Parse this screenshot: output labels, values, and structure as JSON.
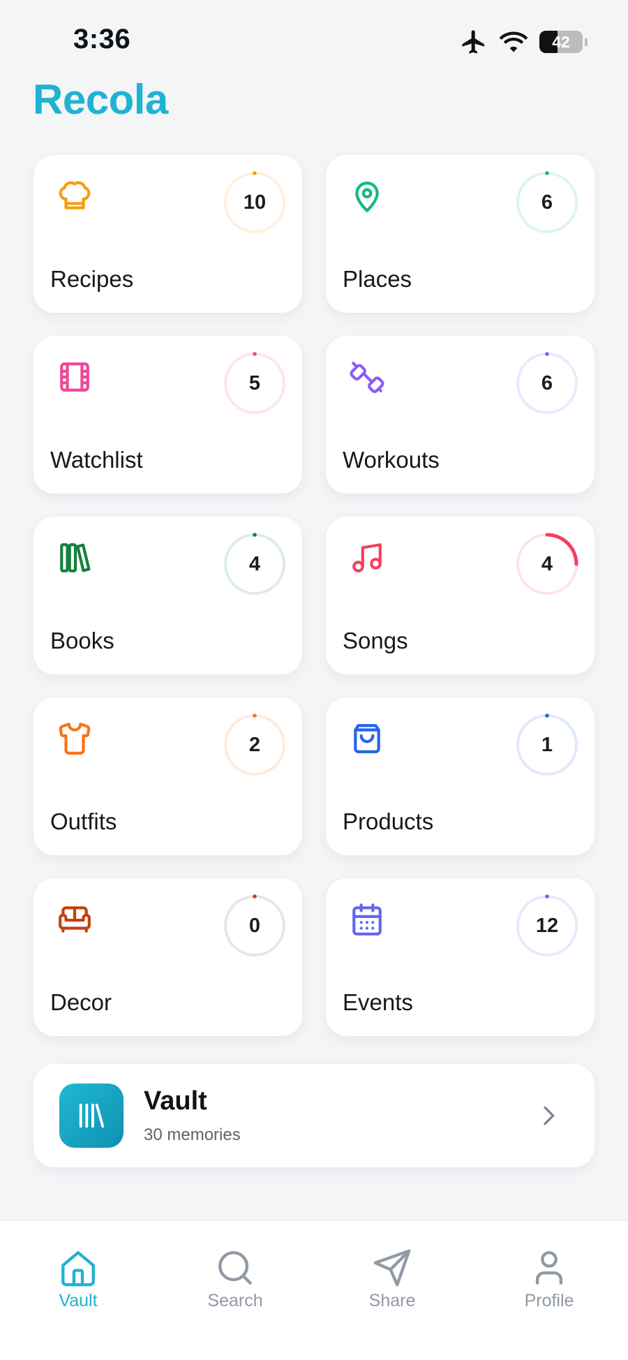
{
  "status_bar": {
    "time": "3:36",
    "battery": "42",
    "battery_level": 0.42
  },
  "app": {
    "title": "Recola"
  },
  "categories": [
    {
      "label": "Recipes",
      "count": "10",
      "icon": "chef-hat-icon",
      "color": "#f59e0b",
      "progress": 0.0
    },
    {
      "label": "Places",
      "count": "6",
      "icon": "map-pin-icon",
      "color": "#10b981",
      "progress": 0.0
    },
    {
      "label": "Watchlist",
      "count": "5",
      "icon": "film-icon",
      "color": "#ec4899",
      "progress": 0.0
    },
    {
      "label": "Workouts",
      "count": "6",
      "icon": "dumbbell-icon",
      "color": "#8b5cf6",
      "progress": 0.0
    },
    {
      "label": "Books",
      "count": "4",
      "icon": "books-icon",
      "color": "#15803d",
      "progress": 0.0
    },
    {
      "label": "Songs",
      "count": "4",
      "icon": "music-note-icon",
      "color": "#f43f5e",
      "progress": 0.25
    },
    {
      "label": "Outfits",
      "count": "2",
      "icon": "shirt-icon",
      "color": "#f97316",
      "progress": 0.0
    },
    {
      "label": "Products",
      "count": "1",
      "icon": "shopping-bag-icon",
      "color": "#2563eb",
      "progress": 0.0
    },
    {
      "label": "Decor",
      "count": "0",
      "icon": "sofa-icon",
      "color": "#c2410c",
      "progress": 0.0
    },
    {
      "label": "Events",
      "count": "12",
      "icon": "calendar-icon",
      "color": "#6366f1",
      "progress": 0.0
    }
  ],
  "vault": {
    "title": "Vault",
    "subtitle": "30 memories"
  },
  "tabs": [
    {
      "label": "Vault",
      "icon": "home-icon",
      "active": true
    },
    {
      "label": "Search",
      "icon": "search-icon",
      "active": false
    },
    {
      "label": "Share",
      "icon": "send-icon",
      "active": false
    },
    {
      "label": "Profile",
      "icon": "user-icon",
      "active": false
    }
  ],
  "colors": {
    "accent": "#1fb3d1",
    "inactive": "#9099a6"
  }
}
